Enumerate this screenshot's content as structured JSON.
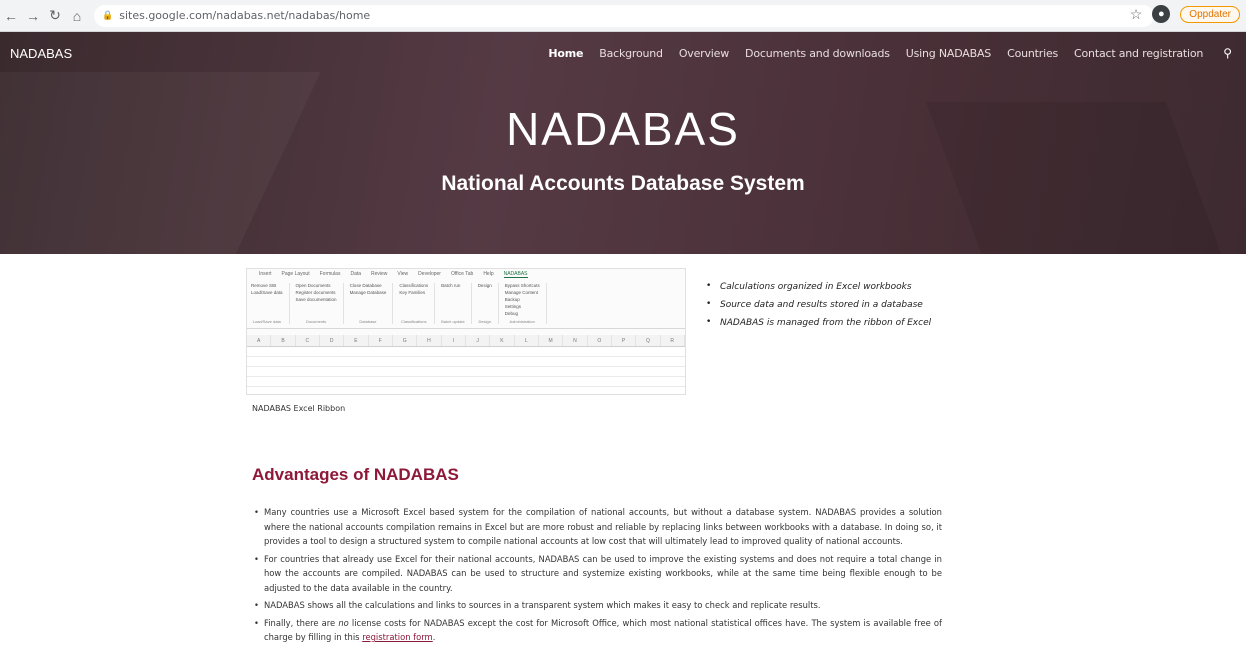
{
  "browser": {
    "url": "sites.google.com/nadabas.net/nadabas/home",
    "update_label": "Oppdater"
  },
  "site": {
    "name": "NADABAS",
    "nav": [
      "Home",
      "Background",
      "Overview",
      "Documents and downloads",
      "Using NADABAS",
      "Countries",
      "Contact and registration"
    ]
  },
  "hero": {
    "title": "NADABAS",
    "subtitle": "National Accounts Database System"
  },
  "ribbon": {
    "tabs": [
      "Insert",
      "Page Layout",
      "Formulas",
      "Data",
      "Review",
      "View",
      "Developer",
      "Office Tab",
      "Help",
      "NADABAS"
    ],
    "groups": [
      {
        "items": [
          "Remove SIB",
          "Load/Save data"
        ],
        "label": "Load/Save data"
      },
      {
        "items": [
          "Open Documents",
          "Register documents",
          "Save documentation"
        ],
        "label": "Documents"
      },
      {
        "items": [
          "Close Database",
          "Manage Database"
        ],
        "label": "Database"
      },
      {
        "items": [
          "Classifications",
          "Key Families"
        ],
        "label": "Classifications"
      },
      {
        "items": [
          "Batch run"
        ],
        "label": "Batch update"
      },
      {
        "items": [
          "Design"
        ],
        "label": "Design"
      },
      {
        "items": [
          "Bypass Shortcuts",
          "Manage Content",
          "Backup",
          "Settings",
          "Debug"
        ],
        "label": "Administration"
      }
    ],
    "columns": [
      "A",
      "B",
      "C",
      "D",
      "E",
      "F",
      "G",
      "H",
      "I",
      "J",
      "K",
      "L",
      "M",
      "N",
      "O",
      "P",
      "Q",
      "R"
    ],
    "caption": "NADABAS Excel Ribbon"
  },
  "features": [
    "Calculations organized in Excel workbooks",
    "Source data and results stored in a database",
    "NADABAS is  managed from the ribbon of Excel"
  ],
  "advantages": {
    "title": "Advantages of NADABAS",
    "items": [
      "Many countries use a Microsoft Excel based system for the compilation of national accounts, but without a database system. NADABAS provides a solution where the national accounts compilation remains in Excel but are more robust and reliable by replacing links between workbooks with a database. In doing so, it provides a tool to design a structured system to compile national accounts at low cost that will ultimately lead to improved quality of national accounts.",
      "For countries that already use Excel for their national accounts, NADABAS can be used to improve the existing systems and does not require a total change in how the accounts are compiled. NADABAS can be used to structure and systemize existing workbooks, while at the same time being flexible enough to be adjusted to the data available in the country.",
      "NADABAS shows all the calculations and links to sources in a transparent system which makes it easy to check and replicate results."
    ],
    "last_item": {
      "before": "Finally, there are ",
      "emphasis": "no",
      "middle": " license costs for NADABAS except the cost for Microsoft Office, which most national statistical offices have. The system is available free of charge  by filling in this ",
      "link": "registration form",
      "after": "."
    }
  }
}
